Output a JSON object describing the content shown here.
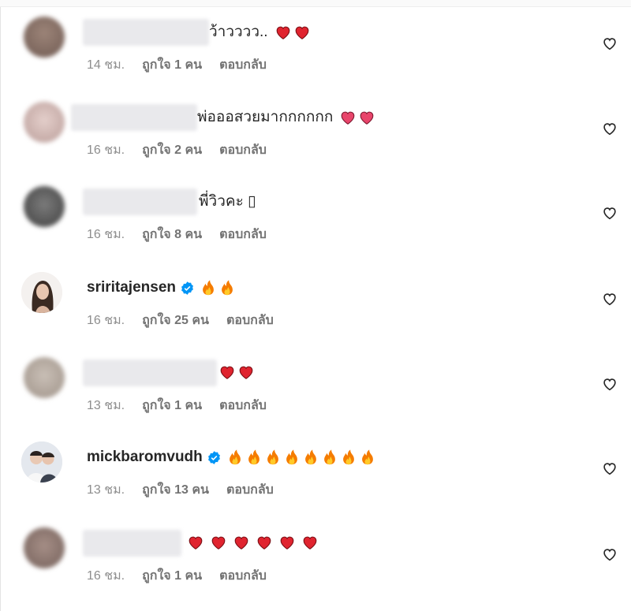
{
  "comments": [
    {
      "text": "ว้าวววว..",
      "emoji": "heart",
      "emoji_count": 2,
      "time": "14 ชม.",
      "likes": "ถูกใจ 1 คน",
      "reply": "ตอบกลับ"
    },
    {
      "text": "พ่อออสวยมากกกกกก",
      "emoji": "pink-heart",
      "emoji_count": 2,
      "time": "16 ชม.",
      "likes": "ถูกใจ 2 คน",
      "reply": "ตอบกลับ"
    },
    {
      "text": "พี่วิวคะ ▯",
      "emoji": "",
      "emoji_count": 0,
      "time": "16 ชม.",
      "likes": "ถูกใจ 8 คน",
      "reply": "ตอบกลับ"
    },
    {
      "username": "sriritajensen",
      "verified": true,
      "emoji": "fire",
      "emoji_count": 2,
      "time": "16 ชม.",
      "likes": "ถูกใจ 25 คน",
      "reply": "ตอบกลับ"
    },
    {
      "text": "",
      "emoji": "heart",
      "emoji_count": 2,
      "time": "13 ชม.",
      "likes": "ถูกใจ 1 คน",
      "reply": "ตอบกลับ"
    },
    {
      "username": "mickbaromvudh",
      "verified": true,
      "emoji": "fire",
      "emoji_count": 8,
      "time": "13 ชม.",
      "likes": "ถูกใจ 13 คน",
      "reply": "ตอบกลับ"
    },
    {
      "text": "",
      "emoji": "heart",
      "emoji_count": 6,
      "time": "16 ชม.",
      "likes": "ถูกใจ 1 คน",
      "reply": "ตอบกลับ"
    }
  ],
  "colors": {
    "verified": "#0095f6",
    "heart": "#e0242f",
    "pink_heart": "#e8456b",
    "fire": "#f57c00",
    "muted": "#8e8e8e"
  },
  "icons": {
    "like": "heart-outline-icon",
    "verified": "verified-badge-icon"
  }
}
